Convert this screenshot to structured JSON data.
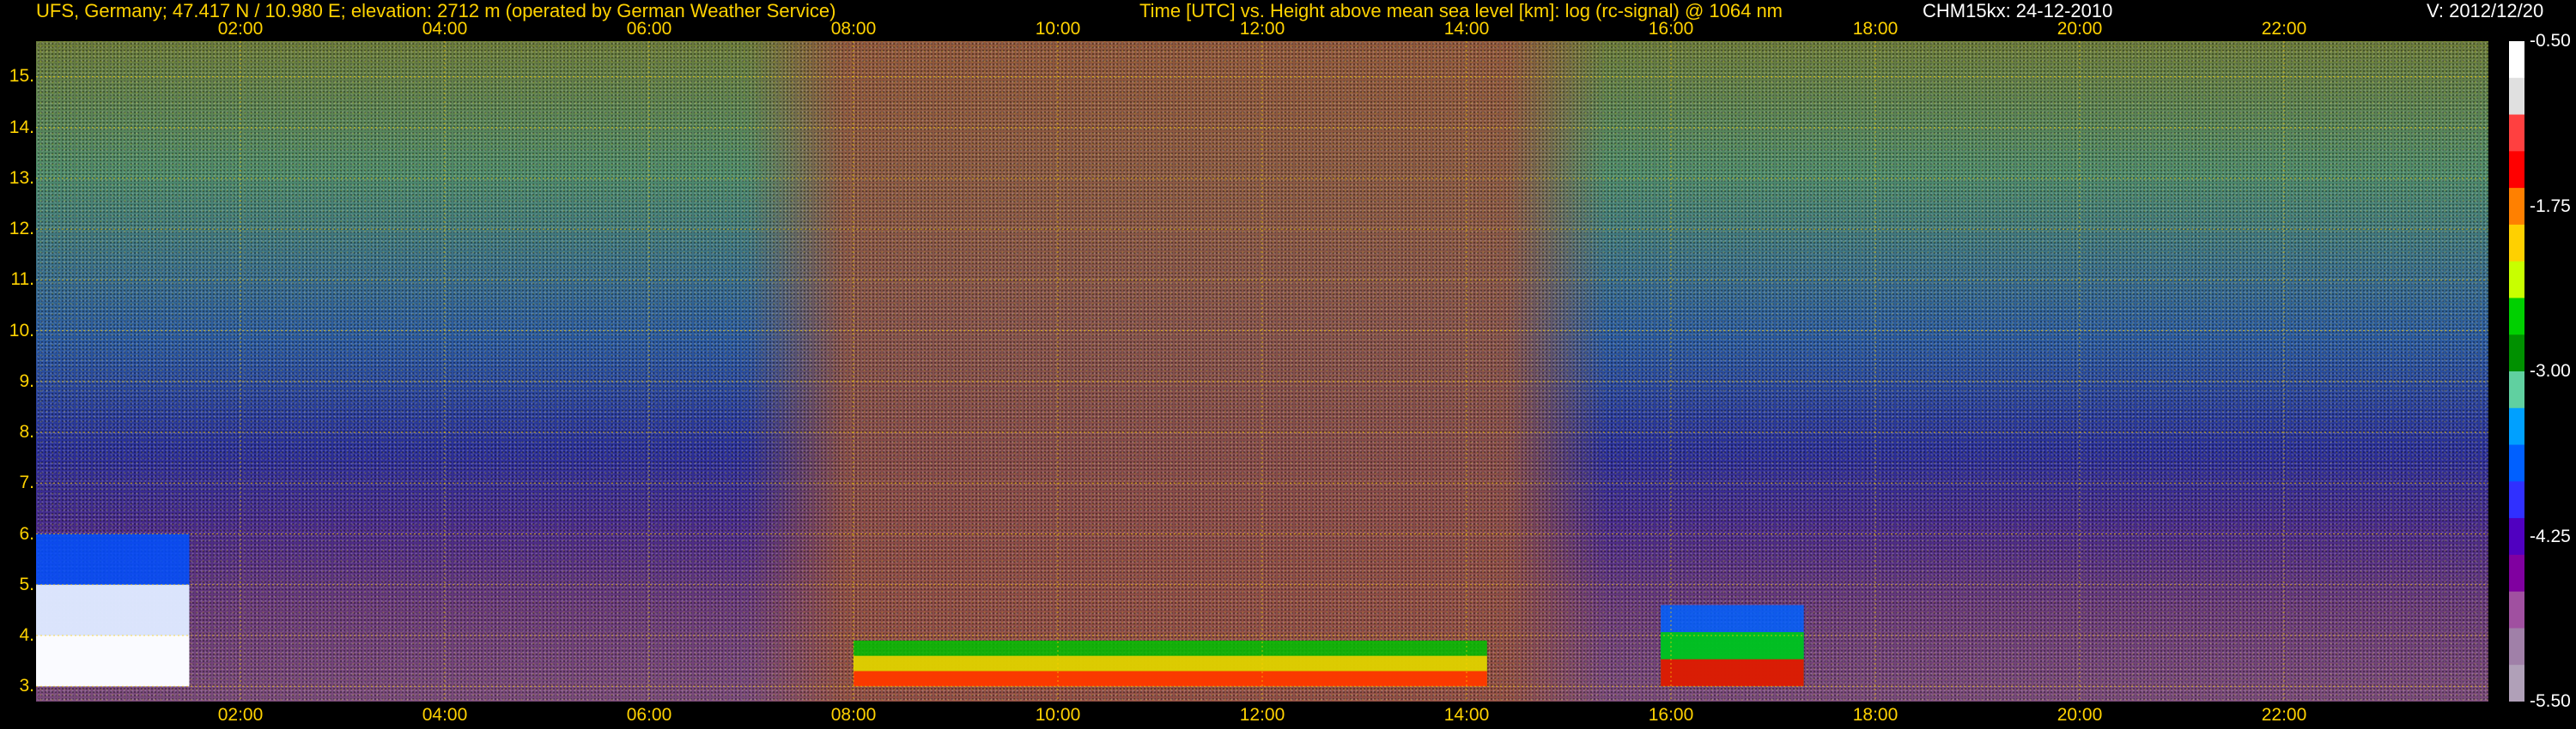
{
  "header": {
    "site": "UFS, Germany; 47.417 N / 10.980 E; elevation: 2712 m  (operated by German Weather Service)",
    "description": "Time [UTC] vs. Height above mean sea level [km]: log (rc-signal) @ 1064 nm",
    "instrument_date": "CHM15kx: 24-12-2010",
    "version": "V: 2012/12/20"
  },
  "chart_data": {
    "type": "heatmap",
    "title": "Time [UTC] vs. Height above mean sea level [km]: log (rc-signal) @ 1064 nm",
    "xlabel": "Time [UTC]",
    "ylabel": "Height above mean sea level [km]",
    "xlim": [
      0,
      24
    ],
    "ylim": [
      2.7,
      15.7
    ],
    "x_ticks": [
      "02:00",
      "04:00",
      "06:00",
      "08:00",
      "10:00",
      "12:00",
      "14:00",
      "16:00",
      "18:00",
      "20:00",
      "22:00"
    ],
    "x_tick_values": [
      2,
      4,
      6,
      8,
      10,
      12,
      14,
      16,
      18,
      20,
      22
    ],
    "y_ticks": [
      "3.",
      "4.",
      "5.",
      "6.",
      "7.",
      "8.",
      "9.",
      "10.",
      "11.",
      "12.",
      "13.",
      "14.",
      "15."
    ],
    "y_tick_values": [
      3,
      4,
      5,
      6,
      7,
      8,
      9,
      10,
      11,
      12,
      13,
      14,
      15
    ],
    "grid": true,
    "colorbar": {
      "ticks": [
        "-0.50",
        "-1.75",
        "-3.00",
        "-4.25",
        "-5.50"
      ],
      "tick_values": [
        -0.5,
        -1.75,
        -3.0,
        -4.25,
        -5.5
      ],
      "range": [
        -5.5,
        -0.5
      ],
      "colors": [
        "#ffffff",
        "#e0e0e0",
        "#ff4040",
        "#ff0000",
        "#ff8000",
        "#ffd000",
        "#c8ff00",
        "#00d000",
        "#009000",
        "#60d0a0",
        "#00a0ff",
        "#0060ff",
        "#3030ff",
        "#5000c0",
        "#8000a0",
        "#a050a0",
        "#a080a8",
        "#b0a0b8"
      ]
    },
    "features": [
      {
        "name": "daytime background band",
        "x": [
          7.3,
          15.5
        ],
        "y": [
          2.7,
          15.7
        ],
        "value": -1.0
      },
      {
        "name": "boundary layer",
        "x": [
          8.0,
          14.2
        ],
        "y": [
          3.0,
          3.9
        ],
        "value": -1.2
      },
      {
        "name": "cloud layer",
        "x": [
          15.9,
          17.3
        ],
        "y": [
          3.0,
          4.6
        ],
        "value": -1.0
      },
      {
        "name": "low cloud early morning",
        "x": [
          0.0,
          1.5
        ],
        "y": [
          3.0,
          6.0
        ],
        "value": -0.8
      }
    ]
  }
}
